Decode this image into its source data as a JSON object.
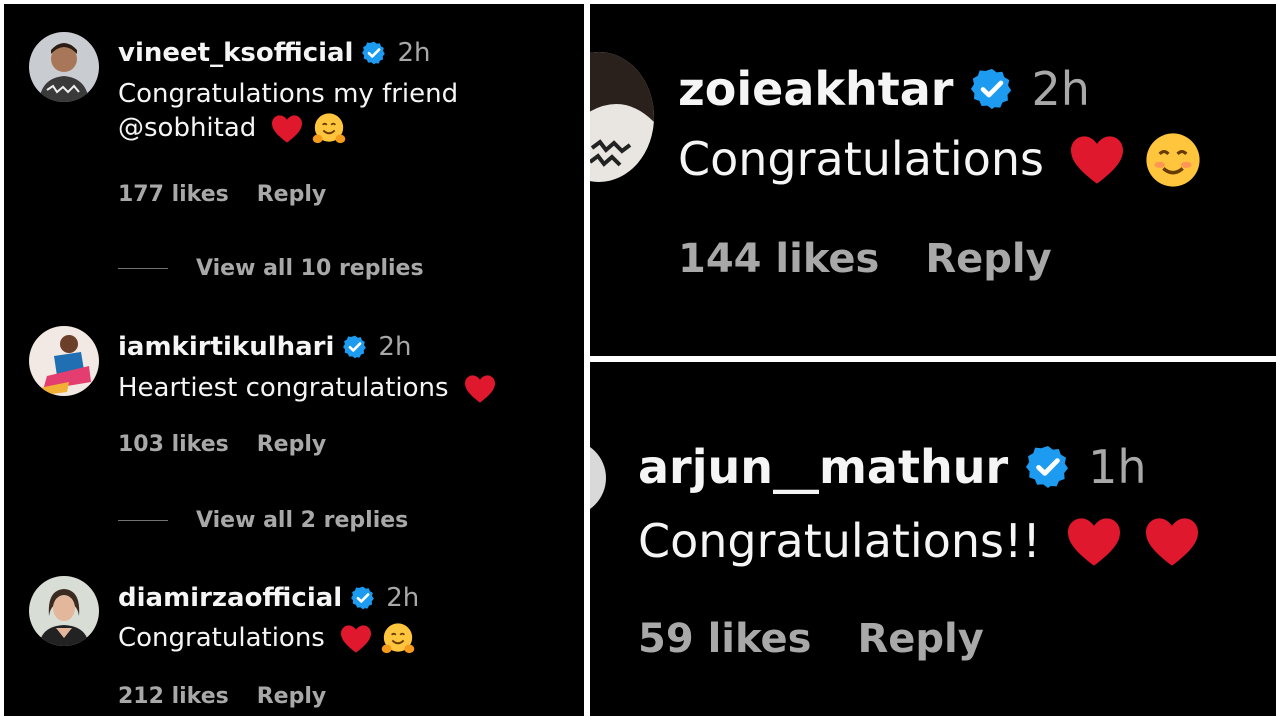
{
  "colors": {
    "background": "#000000",
    "text_primary": "#f5f5f5",
    "text_secondary": "#a8a8a8",
    "verified_badge": "#1d9bf0",
    "heart": "#e0182d"
  },
  "left_panel": {
    "comments": [
      {
        "username": "vineet_ksofficial",
        "time": "2h",
        "text_line1": "Congratulations my friend",
        "text_line2": "@sobhitad",
        "emojis": [
          "heart-icon",
          "hugging-face-icon"
        ],
        "likes": "177 likes",
        "reply": "Reply",
        "view_replies": "View all 10 replies"
      },
      {
        "username": "iamkirtikulhari",
        "time": "2h",
        "text_line1": "Heartiest congratulations",
        "emojis": [
          "heart-icon"
        ],
        "likes": "103 likes",
        "reply": "Reply",
        "view_replies": "View all 2 replies"
      },
      {
        "username": "diamirzaofficial",
        "time": "2h",
        "text_line1": "Congratulations",
        "emojis": [
          "heart-icon",
          "hugging-face-icon"
        ],
        "likes": "212 likes",
        "reply": "Reply"
      }
    ]
  },
  "top_right_panel": {
    "comment": {
      "username": "zoieakhtar",
      "time": "2h",
      "text": "Congratulations",
      "emojis": [
        "heart-icon",
        "smiling-face-icon"
      ],
      "likes": "144 likes",
      "reply": "Reply"
    }
  },
  "bottom_right_panel": {
    "comment": {
      "username": "arjun__mathur",
      "time": "1h",
      "text": "Congratulations!!",
      "emojis": [
        "heart-icon",
        "heart-icon"
      ],
      "likes": "59 likes",
      "reply": "Reply"
    }
  }
}
